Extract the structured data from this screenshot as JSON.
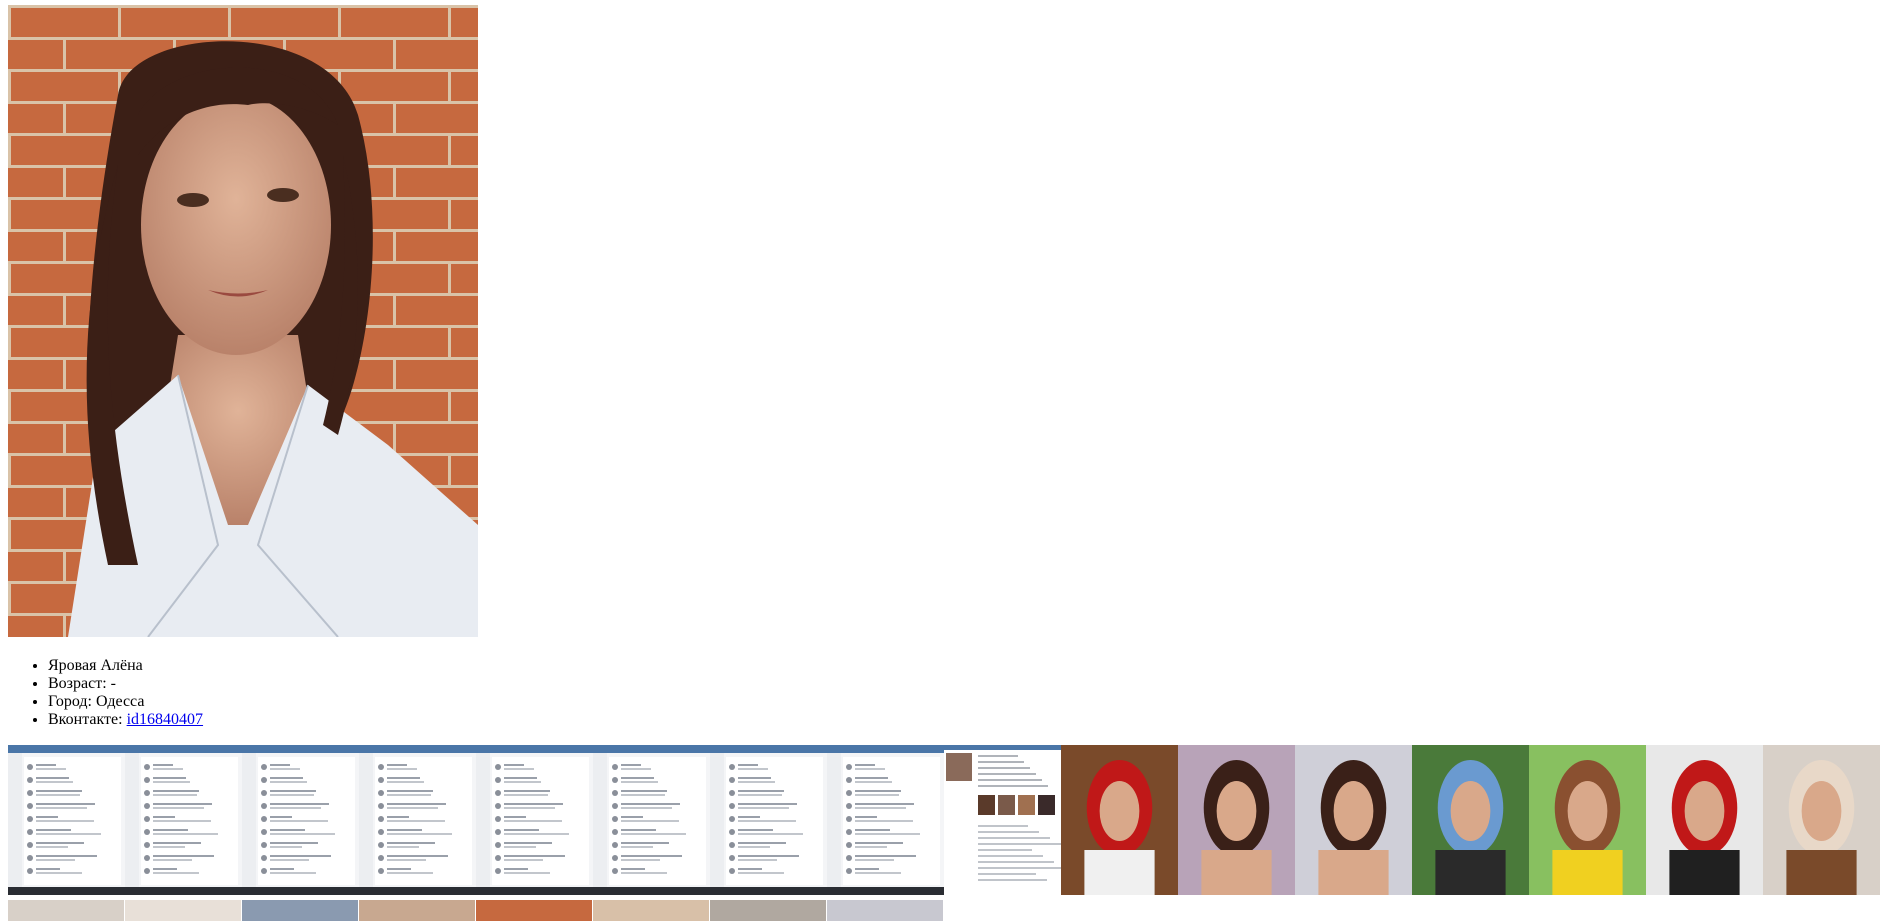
{
  "profile": {
    "name": "Яровая Алёна",
    "age_label": "Возраст:",
    "age_value": "-",
    "city_label": "Город:",
    "city_value": "Одесса",
    "vk_label": "Вконтакте:",
    "vk_link_text": "id16840407"
  },
  "colors": {
    "brick": "#c6693f",
    "mortar": "#d9c3a8",
    "skin": "#d9a88a",
    "hair": "#3b1f16",
    "shirt": "#e8ecf2",
    "link": "#0000ee",
    "vk_header": "#4a76a8"
  },
  "gallery": {
    "thumbs": [
      {
        "kind": "chat-screenshot"
      },
      {
        "kind": "chat-screenshot"
      },
      {
        "kind": "chat-screenshot"
      },
      {
        "kind": "chat-screenshot"
      },
      {
        "kind": "chat-screenshot"
      },
      {
        "kind": "chat-screenshot"
      },
      {
        "kind": "chat-screenshot"
      },
      {
        "kind": "chat-screenshot"
      },
      {
        "kind": "profile-screenshot"
      },
      {
        "kind": "photo",
        "palette": [
          "#7a4a2a",
          "#c01818",
          "#f0f0f0"
        ]
      },
      {
        "kind": "photo",
        "palette": [
          "#b8a3b8",
          "#3a2018",
          "#d9a88a"
        ]
      },
      {
        "kind": "photo",
        "palette": [
          "#cfcfd8",
          "#3a2018",
          "#d9a88a"
        ]
      },
      {
        "kind": "photo",
        "palette": [
          "#4a7a3a",
          "#6a9ad0",
          "#2a2a2a"
        ]
      },
      {
        "kind": "photo",
        "palette": [
          "#88c060",
          "#8a5030",
          "#f0d020"
        ]
      },
      {
        "kind": "photo",
        "palette": [
          "#e8e8e8",
          "#c01818",
          "#202020"
        ]
      },
      {
        "kind": "photo",
        "palette": [
          "#d8d0c8",
          "#e8d8c8",
          "#7a4a2a"
        ]
      }
    ],
    "row2_count": 8
  }
}
